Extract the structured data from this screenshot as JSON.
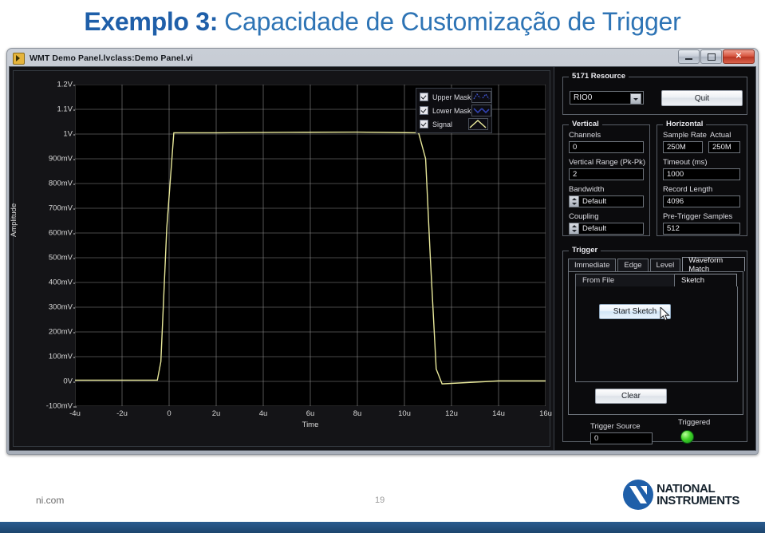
{
  "slide": {
    "title_bold": "Exemplo 3:",
    "title_light": "Capacidade de Customização de Trigger",
    "accent_color": "#1F5FA9"
  },
  "window": {
    "title": "WMT Demo Panel.lvclass:Demo Panel.vi",
    "icon": "labview-vi-icon",
    "buttons": {
      "minimize": "minimize-icon",
      "maximize": "maximize-icon",
      "close": "close-icon"
    }
  },
  "graph": {
    "legend": [
      {
        "label": "Upper Mask",
        "checked": true,
        "color": "#2b3fa8"
      },
      {
        "label": "Lower Mask",
        "checked": true,
        "color": "#2b3fa8"
      },
      {
        "label": "Signal",
        "checked": true,
        "color": "#e8e89a"
      }
    ]
  },
  "chart_data": {
    "type": "line",
    "title": "",
    "xlabel": "Time",
    "ylabel": "Amplitude",
    "xlim": [
      -4,
      16
    ],
    "ylim": [
      -0.1,
      1.2
    ],
    "xticks": [
      "-4u",
      "-2u",
      "0",
      "2u",
      "4u",
      "6u",
      "8u",
      "10u",
      "12u",
      "14u",
      "16u"
    ],
    "xtick_values": [
      -4,
      -2,
      0,
      2,
      4,
      6,
      8,
      10,
      12,
      14,
      16
    ],
    "yticks": [
      "1.2V",
      "1.1V",
      "1V",
      "900mV",
      "800mV",
      "700mV",
      "600mV",
      "500mV",
      "400mV",
      "300mV",
      "200mV",
      "100mV",
      "0V",
      "-100mV"
    ],
    "ytick_values": [
      1.2,
      1.1,
      1.0,
      0.9,
      0.8,
      0.7,
      0.6,
      0.5,
      0.4,
      0.3,
      0.2,
      0.1,
      0.0,
      -0.1
    ],
    "grid": true,
    "background": "#000000",
    "series": [
      {
        "name": "Signal",
        "color": "#e8e89a",
        "x": [
          -4.0,
          -0.5,
          -0.35,
          -0.1,
          0.2,
          2.0,
          5.0,
          8.0,
          10.6,
          10.9,
          11.1,
          11.35,
          11.6,
          14.0,
          16.0
        ],
        "y": [
          0.005,
          0.005,
          0.08,
          0.62,
          1.005,
          1.005,
          1.007,
          1.008,
          1.005,
          0.9,
          0.5,
          0.05,
          -0.01,
          0.002,
          0.002
        ]
      }
    ]
  },
  "resource_group": {
    "title": "5171 Resource",
    "device_value": "RIO0",
    "quit_label": "Quit"
  },
  "vertical_group": {
    "title": "Vertical",
    "fields": [
      {
        "label": "Channels",
        "value": "0",
        "type": "text"
      },
      {
        "label": "Vertical Range (Pk-Pk)",
        "value": "2",
        "type": "text"
      },
      {
        "label": "Bandwidth",
        "value": "Default",
        "type": "spinner"
      },
      {
        "label": "Coupling",
        "value": "Default",
        "type": "spinner"
      }
    ]
  },
  "horizontal_group": {
    "title": "Horizontal",
    "sample_rate_label": "Sample Rate",
    "sample_rate_value": "250M",
    "actual_label": "Actual",
    "actual_value": "250M",
    "fields": [
      {
        "label": "Timeout (ms)",
        "value": "1000"
      },
      {
        "label": "Record Length",
        "value": "4096"
      },
      {
        "label": "Pre-Trigger Samples",
        "value": "512"
      }
    ]
  },
  "trigger_group": {
    "title": "Trigger",
    "tabs": [
      {
        "label": "Immediate",
        "active": false
      },
      {
        "label": "Edge",
        "active": false
      },
      {
        "label": "Level",
        "active": false
      },
      {
        "label": "Waveform Match",
        "active": true
      }
    ],
    "subtabs": [
      {
        "label": "From File",
        "active": false
      },
      {
        "label": "Sketch",
        "active": true
      }
    ],
    "start_sketch_label": "Start Sketch",
    "clear_label": "Clear",
    "trigger_source_label": "Trigger Source",
    "trigger_source_value": "0",
    "triggered_label": "Triggered",
    "triggered_state": true,
    "triggered_color": "#3ecb27"
  },
  "footer": {
    "site": "ni.com",
    "page": "19",
    "logo_line1": "NATIONAL",
    "logo_line2": "INSTRUMENTS",
    "bar_color": "#24527f"
  }
}
